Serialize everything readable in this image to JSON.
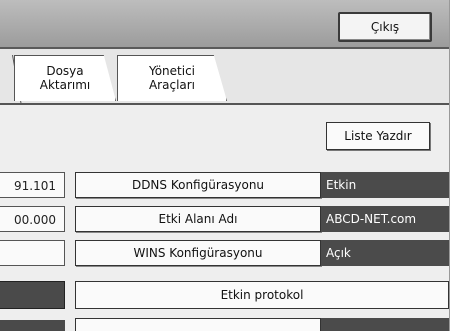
{
  "header": {
    "exit_label": "Çıkış"
  },
  "tabs": [
    {
      "label_line1": "Dosya",
      "label_line2": "Aktarımı"
    },
    {
      "label_line1": "Yönetici",
      "label_line2": "Araçları"
    }
  ],
  "toolbar": {
    "print_list_label": "Liste Yazdır"
  },
  "rows": [
    {
      "left_value": "91.101",
      "button_label": "DDNS Konfigürasyonu",
      "value": "Etkin"
    },
    {
      "left_value": "00.000",
      "button_label": "Etki Alanı Adı",
      "value": "ABCD-NET.com"
    },
    {
      "left_value": "",
      "button_label": "WINS Konfigürasyonu",
      "value": "Açık"
    }
  ],
  "protocol_button_label": "Etkin protokol"
}
